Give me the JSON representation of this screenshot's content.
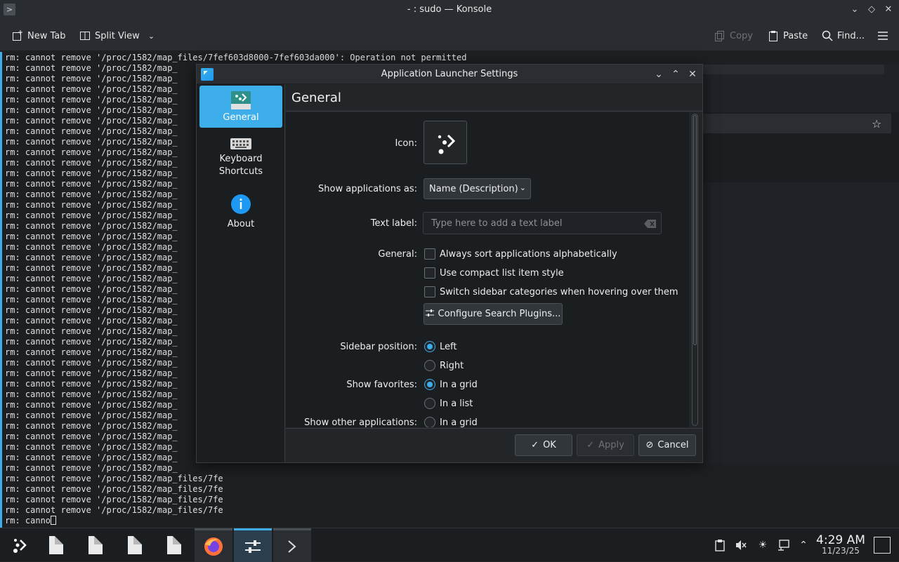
{
  "window": {
    "title": "- : sudo — Konsole"
  },
  "toolbar": {
    "new_tab": "New Tab",
    "split_view": "Split View",
    "copy": "Copy",
    "paste": "Paste",
    "find": "Find..."
  },
  "terminal": {
    "first_line": "rm: cannot remove '/proc/1582/map_files/7fef603d8000-7fef603da000': Operation not permitted",
    "truncated_line": "rm: cannot remove '/proc/1582/map_",
    "tail_line": "rm: cannot remove '/proc/1582/map_files/7fe",
    "prompt_line": "rm: canno"
  },
  "dialog": {
    "title": "Application Launcher Settings",
    "sidebar": [
      {
        "label": "General"
      },
      {
        "label": "Keyboard Shortcuts"
      },
      {
        "label": "About"
      }
    ],
    "header": "General",
    "labels": {
      "icon": "Icon:",
      "show_apps": "Show applications as:",
      "text_label": "Text label:",
      "general": "General:",
      "sidebar_position": "Sidebar position:",
      "show_favorites": "Show favorites:",
      "show_other": "Show other applications:"
    },
    "show_apps_value": "Name (Description)",
    "text_label_placeholder": "Type here to add a text label",
    "checkboxes": [
      {
        "label": "Always sort applications alphabetically",
        "checked": false
      },
      {
        "label": "Use compact list item style",
        "checked": false
      },
      {
        "label": "Switch sidebar categories when hovering over them",
        "checked": false
      }
    ],
    "configure_button": "Configure Search Plugins...",
    "sidebar_position": {
      "left": "Left",
      "right": "Right",
      "selected": "Left"
    },
    "favorites": {
      "grid": "In a grid",
      "list": "In a list",
      "selected": "In a grid"
    },
    "other_apps": {
      "grid": "In a grid"
    },
    "buttons": {
      "ok": "OK",
      "apply": "Apply",
      "cancel": "Cancel"
    }
  },
  "taskbar": {
    "time": "4:29 AM",
    "date": "11/23/25"
  },
  "colors": {
    "accent": "#3daee9",
    "background": "#232629",
    "terminal_bg": "#1d1f22"
  }
}
